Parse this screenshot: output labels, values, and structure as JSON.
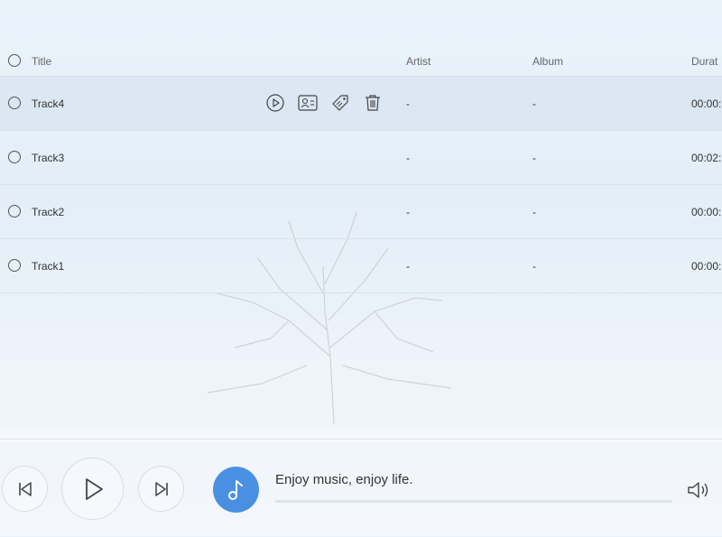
{
  "columns": {
    "title": "Title",
    "artist": "Artist",
    "album": "Album",
    "duration": "Durat"
  },
  "tracks": [
    {
      "title": "Track4",
      "artist": "-",
      "album": "-",
      "duration": "00:00:"
    },
    {
      "title": "Track3",
      "artist": "-",
      "album": "-",
      "duration": "00:02:"
    },
    {
      "title": "Track2",
      "artist": "-",
      "album": "-",
      "duration": "00:00:"
    },
    {
      "title": "Track1",
      "artist": "-",
      "album": "-",
      "duration": "00:00:"
    }
  ],
  "row_actions": [
    "play-icon",
    "contact-card-icon",
    "tag-icon",
    "trash-icon"
  ],
  "player": {
    "now_playing": "Enjoy music, enjoy life.",
    "progress": 0,
    "controls": [
      "previous-icon",
      "play-icon",
      "next-icon",
      "volume-icon"
    ]
  },
  "colors": {
    "accent": "#4a90e2",
    "row_hover": "#d2e0ee"
  }
}
